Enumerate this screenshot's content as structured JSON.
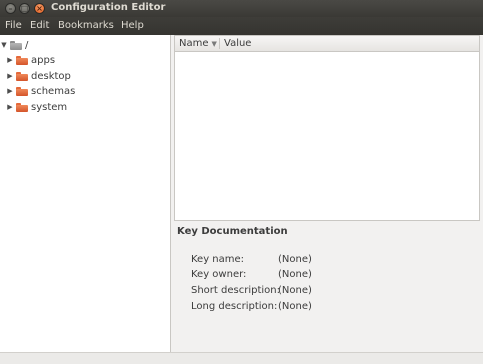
{
  "window": {
    "title": "Configuration Editor"
  },
  "titlebar_buttons": {
    "close_glyph": "×",
    "minimize_glyph": "–",
    "maximize_glyph": "□"
  },
  "menubar": {
    "items": [
      "File",
      "Edit",
      "Bookmarks",
      "Help"
    ]
  },
  "tree": {
    "root": {
      "label": "/",
      "expanded": true,
      "folder_color": "#9a9a9a"
    },
    "children": [
      {
        "label": "apps",
        "folder_color": "#e4693a"
      },
      {
        "label": "desktop",
        "folder_color": "#e4693a"
      },
      {
        "label": "schemas",
        "folder_color": "#e4693a"
      },
      {
        "label": "system",
        "folder_color": "#e4693a"
      }
    ],
    "expand_glyph": "▶",
    "expanded_glyph": "▼"
  },
  "key_list": {
    "columns": [
      {
        "label": "Name",
        "sort_indicator": "▼"
      },
      {
        "label": "Value"
      }
    ],
    "rows": []
  },
  "key_documentation": {
    "title": "Key Documentation",
    "fields": [
      {
        "label": "Key name:",
        "value": "(None)"
      },
      {
        "label": "Key owner:",
        "value": "(None)"
      },
      {
        "label": "Short description:",
        "value": "(None)"
      },
      {
        "label": "Long description:",
        "value": "(None)"
      }
    ]
  },
  "colors": {
    "titlebar": "#3c3b37",
    "accent_close": "#e25a1b",
    "folder": "#e4693a"
  }
}
